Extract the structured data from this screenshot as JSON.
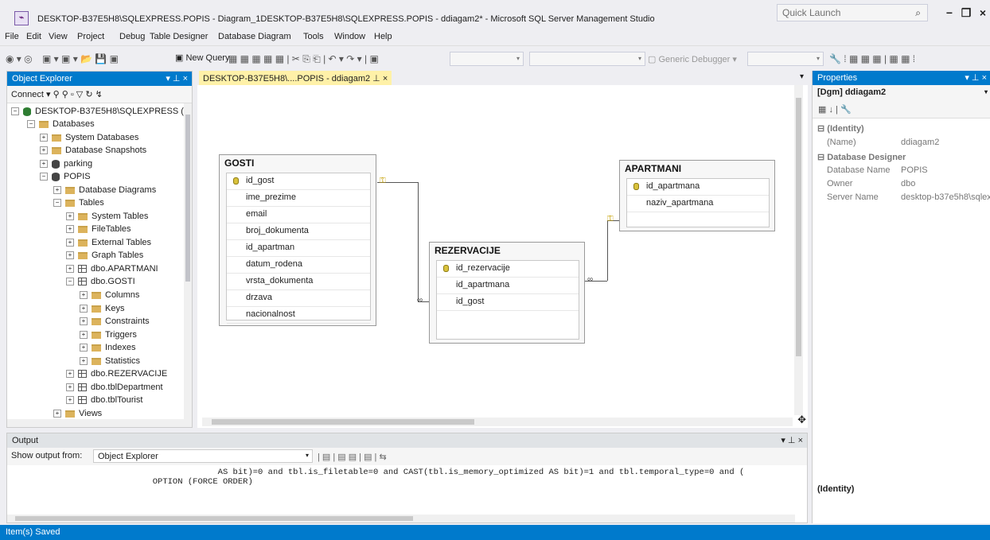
{
  "window": {
    "title": "DESKTOP-B37E5H8\\SQLEXPRESS.POPIS - Diagram_1DESKTOP-B37E5H8\\SQLEXPRESS.POPIS - ddiagam2* - Microsoft SQL Server Management Studio",
    "quick_launch": "Quick Launch"
  },
  "menu": [
    "File",
    "Edit",
    "View",
    "Project",
    "Debug",
    "Table Designer",
    "Database Diagram",
    "Tools",
    "Window",
    "Help"
  ],
  "toolbar": {
    "new_query": "New Query",
    "debugger": "Generic Debugger"
  },
  "object_explorer": {
    "title": "Object Explorer",
    "connect": "Connect",
    "tree": [
      "DESKTOP-B37E5H8\\SQLEXPRESS (SQ",
      "Databases",
      "System Databases",
      "Database Snapshots",
      "parking",
      "POPIS",
      "Database Diagrams",
      "Tables",
      "System Tables",
      "FileTables",
      "External Tables",
      "Graph Tables",
      "dbo.APARTMANI",
      "dbo.GOSTI",
      "Columns",
      "Keys",
      "Constraints",
      "Triggers",
      "Indexes",
      "Statistics",
      "dbo.REZERVACIJE",
      "dbo.tblDepartment",
      "dbo.tblTourist",
      "Views"
    ]
  },
  "editor": {
    "tab": "DESKTOP-B37E5H8\\....POPIS - ddiagam2"
  },
  "diagram": {
    "gosti": {
      "name": "GOSTI",
      "columns": [
        "id_gost",
        "ime_prezime",
        "email",
        "broj_dokumenta",
        "id_apartman",
        "datum_rodena",
        "vrsta_dokumenta",
        "drzava",
        "nacionalnost"
      ]
    },
    "rezervacije": {
      "name": "REZERVACIJE",
      "columns": [
        "id_rezervacije",
        "id_apartmana",
        "id_gost"
      ]
    },
    "apartmani": {
      "name": "APARTMANI",
      "columns": [
        "id_apartmana",
        "naziv_apartmana"
      ]
    }
  },
  "properties": {
    "title": "Properties",
    "object": "[Dgm] ddiagam2",
    "identity": "(Identity)",
    "name_key": "(Name)",
    "name_value": "ddiagam2",
    "designer": "Database Designer",
    "db_key": "Database Name",
    "db_value": "POPIS",
    "owner_key": "Owner",
    "owner_value": "dbo",
    "server_key": "Server Name",
    "server_value": "desktop-b37e5h8\\sqlex",
    "description": "(Identity)"
  },
  "output": {
    "title": "Output",
    "show_from": "Show output from:",
    "source": "Object Explorer",
    "line1": "                                          AS bit)=0 and tbl.is_filetable=0 and CAST(tbl.is_memory_optimized AS bit)=1 and tbl.temporal_type=0 and (",
    "line2": "                             OPTION (FORCE ORDER)"
  },
  "status": "Item(s) Saved"
}
